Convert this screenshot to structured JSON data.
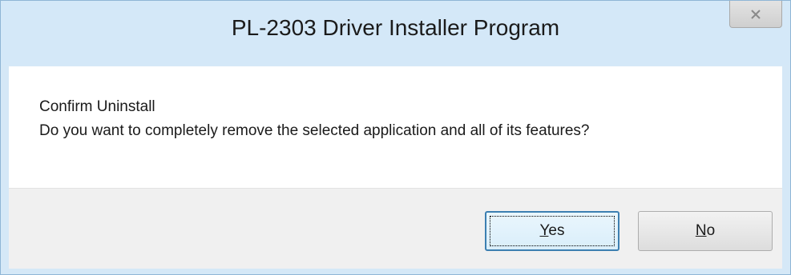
{
  "window": {
    "title": "PL-2303 Driver Installer Program",
    "close_icon": "close-icon"
  },
  "message": {
    "heading": "Confirm Uninstall",
    "body": "Do you want to completely remove the selected application and all of its features?"
  },
  "buttons": {
    "yes": {
      "label": "Yes",
      "accelerator": "Y",
      "rest": "es",
      "focused": true
    },
    "no": {
      "label": "No",
      "accelerator": "N",
      "rest": "o",
      "focused": false
    }
  },
  "colors": {
    "frame": "#d5e8f7",
    "default_button_border": "#3c7fb1",
    "button_bar": "#f0f0f0"
  }
}
